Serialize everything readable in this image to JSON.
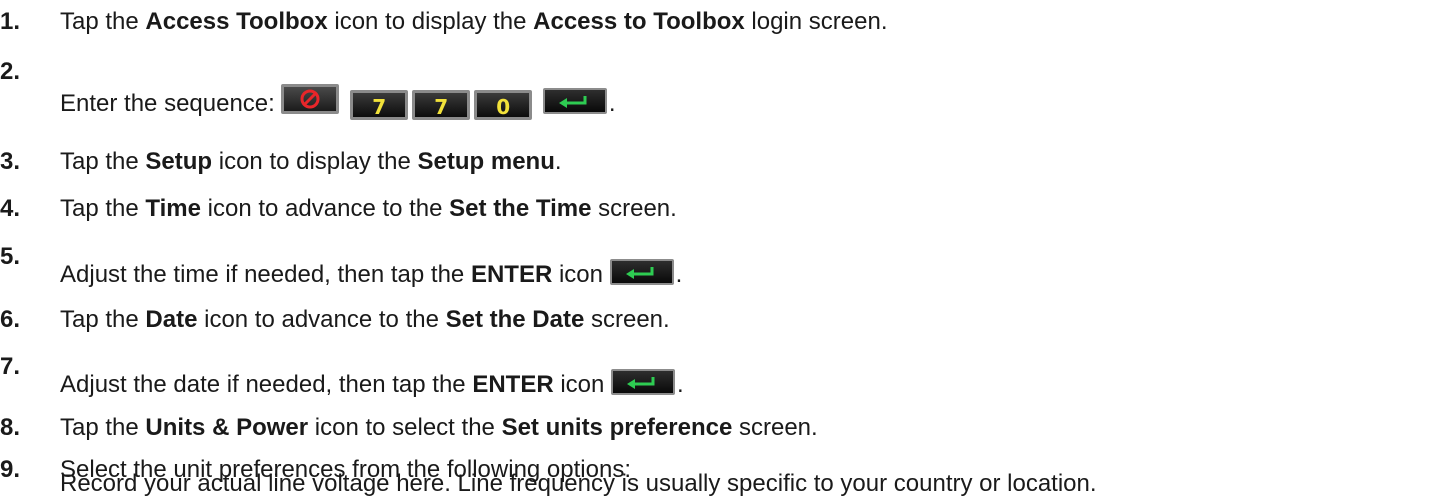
{
  "steps": [
    {
      "num": "1.",
      "parts": [
        "Tap the ",
        "Access Toolbox",
        " icon to display the ",
        "Access to Toolbox",
        " login screen."
      ]
    },
    {
      "num": "2.",
      "parts": [
        "Enter the sequence: ",
        "."
      ],
      "keys": [
        "cancel-icon",
        "7",
        "7",
        "0",
        "enter-icon"
      ]
    },
    {
      "num": "3.",
      "parts": [
        "Tap the ",
        "Setup",
        " icon to display the ",
        "Setup menu",
        "."
      ]
    },
    {
      "num": "4.",
      "parts": [
        "Tap the ",
        "Time",
        " icon to advance to the ",
        "Set the Time",
        " screen."
      ]
    },
    {
      "num": "5.",
      "parts": [
        "Adjust the time if needed, then tap the ",
        "ENTER",
        " icon ",
        "."
      ]
    },
    {
      "num": "6.",
      "parts": [
        "Tap the ",
        "Date",
        " icon to advance to the ",
        "Set the Date",
        " screen."
      ]
    },
    {
      "num": "7.",
      "parts": [
        "Adjust the date if needed, then tap the ",
        "ENTER",
        " icon ",
        "."
      ]
    },
    {
      "num": "8.",
      "parts": [
        "Tap the ",
        "Units & Power",
        " icon to select the ",
        "Set units preference",
        " screen."
      ]
    },
    {
      "num": "9.",
      "parts": [
        "Select the unit preferences from the following options:"
      ],
      "line2": "Record your actual line voltage here. Line frequency is usually specific to your country or location."
    }
  ],
  "colors": {
    "text": "#1a1a1a",
    "key_digit": "#f2e23a",
    "enter_arrow": "#2ecc52",
    "cancel_ring": "#e8262a"
  }
}
